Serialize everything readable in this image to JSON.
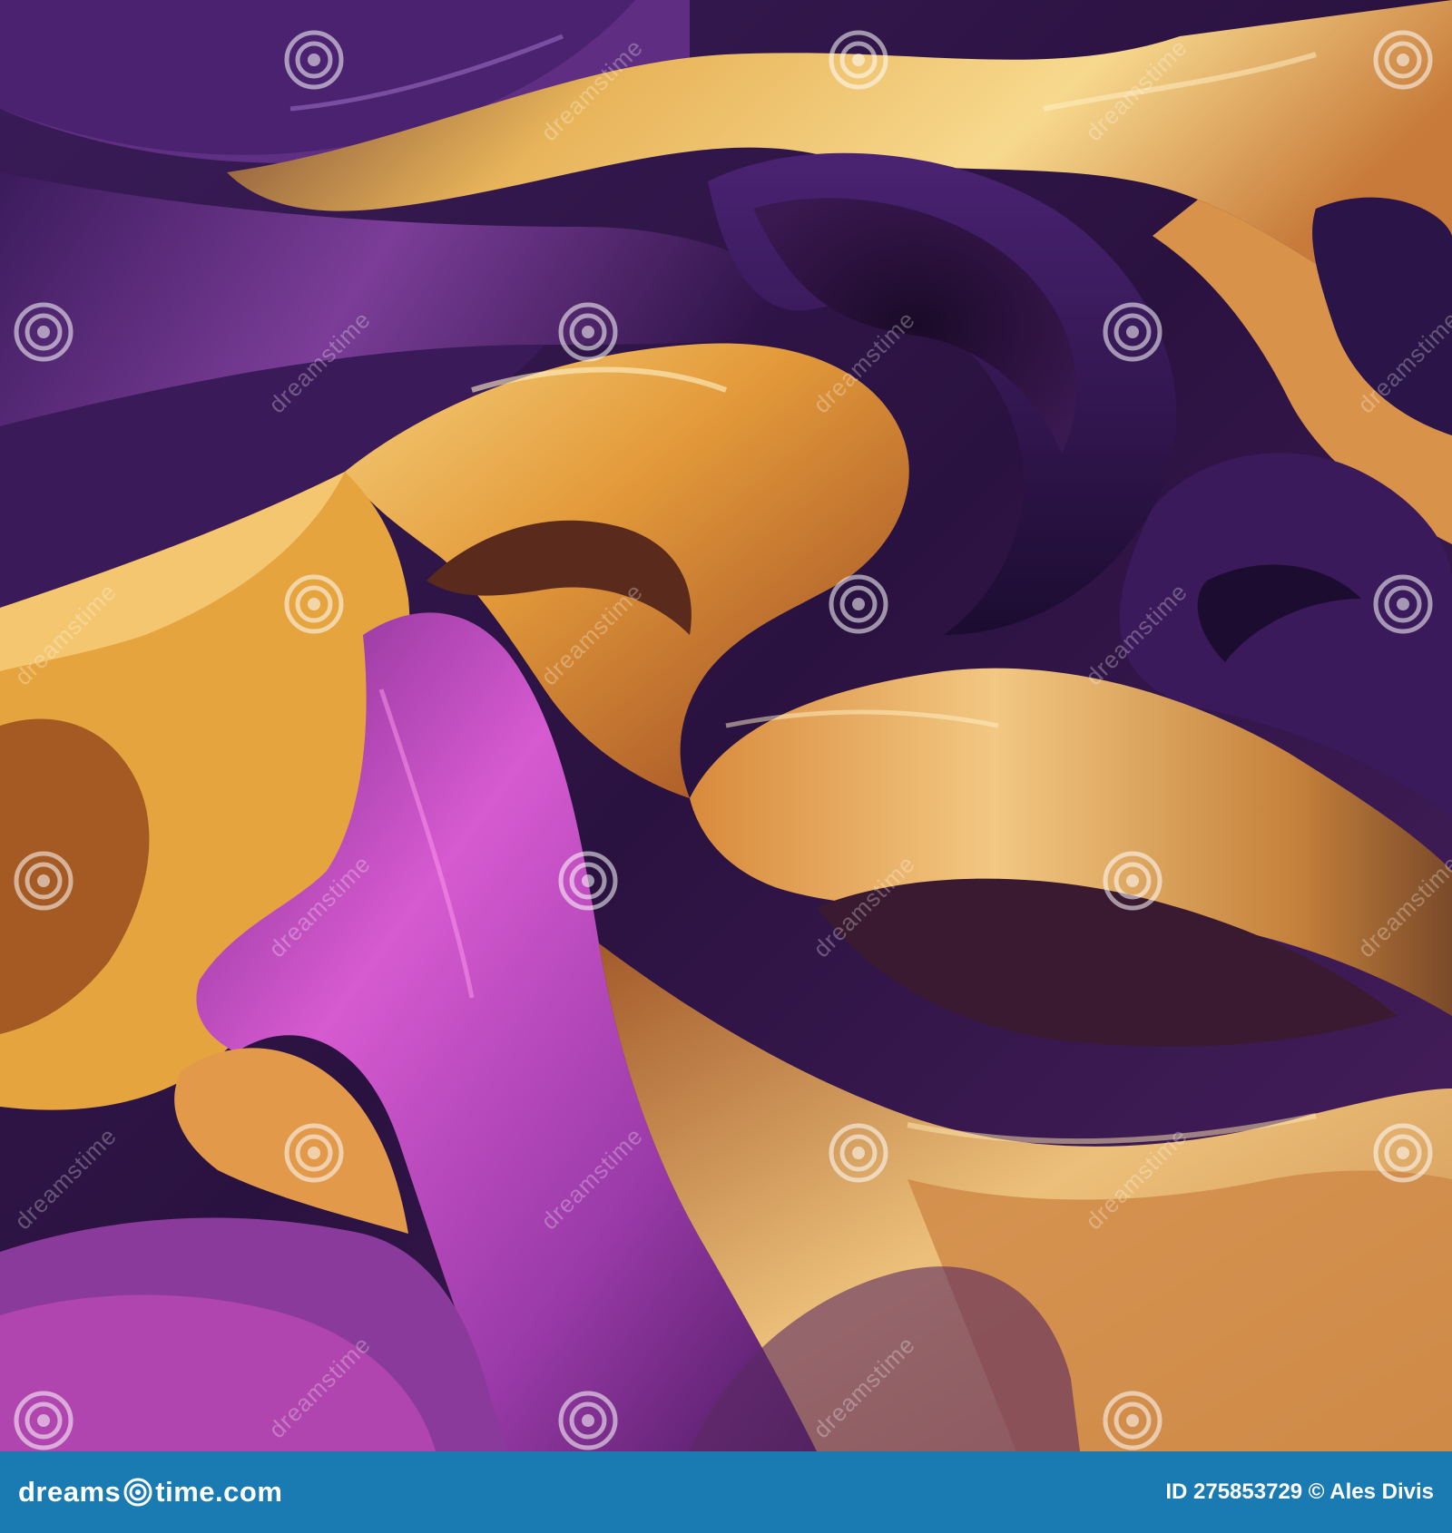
{
  "image": {
    "subject": "abstract silk fabric",
    "colors": {
      "purple": "#5b2a7a",
      "deep_purple": "#2a1240",
      "magenta": "#b23fb3",
      "gold": "#e2a83a",
      "light_gold": "#f3d28a",
      "orange": "#d9782f"
    }
  },
  "footer": {
    "brand_prefix": "dreams",
    "brand_suffix": "time.com",
    "credit": "ID 275853729 © Ales Divis",
    "background": "#1a7ab2"
  },
  "watermark": {
    "text": "dreamstime",
    "icon": "spiral-icon"
  }
}
